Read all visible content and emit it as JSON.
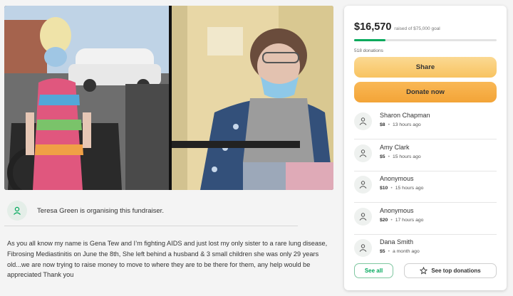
{
  "photos": {
    "left": {
      "icon": "fundraiser-photo-wheelchair"
    },
    "right": {
      "icon": "fundraiser-photo-hospital"
    }
  },
  "organiser": {
    "icon": "person-icon",
    "text": "Teresa Green is organising this fundraiser."
  },
  "story": "As you all know my name is Gena Tew and I’m fighting AIDS and just lost my only sister to a rare lung disease, Fibrosing Mediastinitis on June the 8th, She left behind a husband & 3 small children she was only 29 years old...we are now trying to raise money to move to where they are to be there for them, any help would be appreciated Thank you",
  "donation_card": {
    "amount_raised": "$16,570",
    "goal_text": "raised of $75,000 goal",
    "progress_fraction": 0.221,
    "donations_count": "518 donations",
    "share_label": "Share",
    "donate_label": "Donate now",
    "donors": [
      {
        "name": "Sharon Chapman",
        "amount": "$8",
        "time": "13 hours ago"
      },
      {
        "name": "Amy Clark",
        "amount": "$5",
        "time": "15 hours ago"
      },
      {
        "name": "Anonymous",
        "amount": "$10",
        "time": "15 hours ago"
      },
      {
        "name": "Anonymous",
        "amount": "$20",
        "time": "17 hours ago"
      },
      {
        "name": "Dana Smith",
        "amount": "$5",
        "time": "a month ago"
      }
    ],
    "see_all_label": "See all",
    "top_donations_label": "See top donations",
    "top_donations_icon": "star-icon",
    "donor_icon": "donation-heart-icon"
  },
  "colors": {
    "brand_green": "#02a95c",
    "share_yellow": "#f8c360",
    "donate_orange": "#f3a437"
  }
}
